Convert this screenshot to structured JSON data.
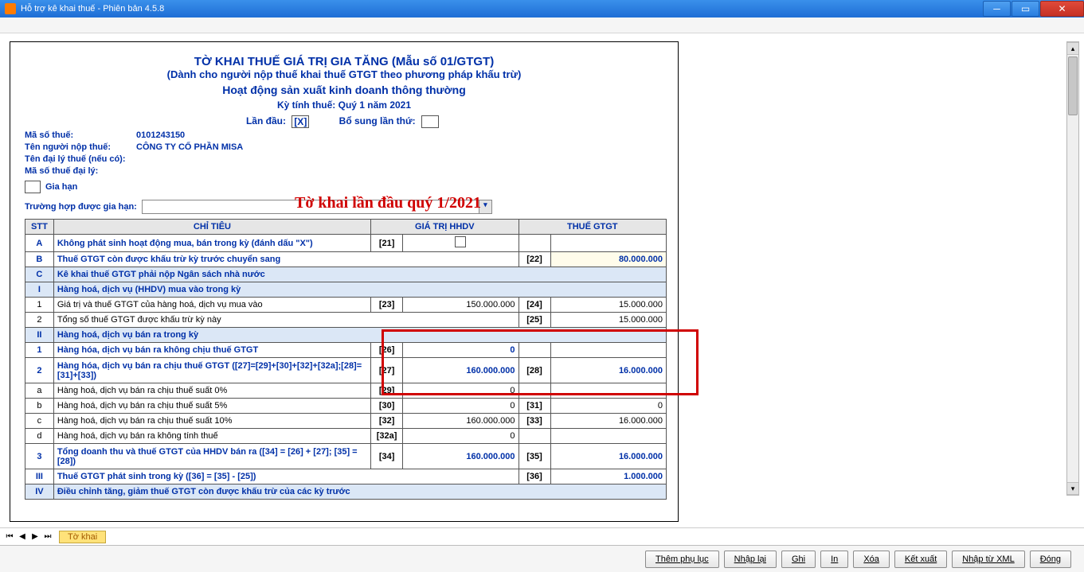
{
  "window": {
    "title": "Hỗ trợ kê khai thuế -   Phiên bản 4.5.8"
  },
  "form": {
    "title": "TỜ KHAI THUẾ GIÁ TRỊ GIA TĂNG (Mẫu số 01/GTGT)",
    "subtitle": "(Dành cho người nộp thuế khai thuế GTGT theo phương pháp khấu trừ)",
    "activity": "Hoạt động sản xuất kinh doanh thông thường",
    "period": "Kỳ tính thuế: Quý 1 năm 2021",
    "landau_lbl": "Lần đầu:",
    "landau_val": "[X]",
    "bosung_lbl": "Bổ sung lần thứ:",
    "bosung_val": "",
    "info": {
      "mst_lbl": "Mã số thuế:",
      "mst_val": "0101243150",
      "ten_lbl": "Tên người nộp thuế:",
      "ten_val": "CÔNG TY CỔ PHẦN MISA",
      "dl_lbl": "Tên đại lý thuế (nếu có):",
      "dl_val": "",
      "mstdl_lbl": "Mã số thuế đại lý:",
      "mstdl_val": ""
    },
    "red_note": "Tờ khai lần đầu quý 1/2021",
    "giahan_lbl": "Gia hạn",
    "ext_lbl": "Trường hợp được gia hạn:"
  },
  "headers": {
    "stt": "STT",
    "chitieu": "CHỈ TIÊU",
    "hhdv": "GIÁ TRỊ HHDV",
    "thue": "THUẾ GTGT"
  },
  "rows": {
    "A": {
      "stt": "A",
      "desc": "Không phát sinh hoạt động mua, bán trong kỳ (đánh dấu \"X\")",
      "c1": "[21]",
      "v1": "",
      "c2": "",
      "v2": ""
    },
    "B": {
      "stt": "B",
      "desc": "Thuế GTGT còn được khấu trừ kỳ trước chuyển sang",
      "c1": "",
      "v1": "",
      "c2": "[22]",
      "v2": "80.000.000"
    },
    "C": {
      "stt": "C",
      "desc": "Kê khai thuế GTGT phải nộp Ngân sách nhà nước"
    },
    "I": {
      "stt": "I",
      "desc": "Hàng hoá, dịch vụ (HHDV) mua vào trong kỳ"
    },
    "r1": {
      "stt": "1",
      "desc": "Giá trị và thuế GTGT của hàng hoá, dịch vụ mua vào",
      "c1": "[23]",
      "v1": "150.000.000",
      "c2": "[24]",
      "v2": "15.000.000"
    },
    "r2": {
      "stt": "2",
      "desc": "Tổng số thuế GTGT được khấu trừ kỳ này",
      "c1": "",
      "v1": "",
      "c2": "[25]",
      "v2": "15.000.000"
    },
    "II": {
      "stt": "II",
      "desc": "Hàng hoá, dịch vụ bán ra trong kỳ"
    },
    "s1": {
      "stt": "1",
      "desc": "Hàng hóa, dịch vụ bán ra không chịu thuế GTGT",
      "c1": "[26]",
      "v1": "0",
      "c2": "",
      "v2": ""
    },
    "s2": {
      "stt": "2",
      "desc": "Hàng hóa, dịch vụ bán ra chịu thuế GTGT ([27]=[29]+[30]+[32]+[32a];[28]=[31]+[33])",
      "c1": "[27]",
      "v1": "160.000.000",
      "c2": "[28]",
      "v2": "16.000.000"
    },
    "sa": {
      "stt": "a",
      "desc": "Hàng hoá, dịch vụ bán ra chịu thuế suất 0%",
      "c1": "[29]",
      "v1": "0",
      "c2": "",
      "v2": ""
    },
    "sb": {
      "stt": "b",
      "desc": "Hàng hoá, dịch vụ bán ra chịu thuế suất 5%",
      "c1": "[30]",
      "v1": "0",
      "c2": "[31]",
      "v2": "0"
    },
    "sc": {
      "stt": "c",
      "desc": "Hàng hoá, dịch vụ bán ra chịu thuế suất 10%",
      "c1": "[32]",
      "v1": "160.000.000",
      "c2": "[33]",
      "v2": "16.000.000"
    },
    "sd": {
      "stt": "d",
      "desc": "Hàng hoá, dịch vụ bán ra không tính thuế",
      "c1": "[32a]",
      "v1": "0",
      "c2": "",
      "v2": ""
    },
    "s3": {
      "stt": "3",
      "desc": "Tổng doanh thu và thuế GTGT của HHDV bán ra ([34] = [26] + [27]; [35] = [28])",
      "c1": "[34]",
      "v1": "160.000.000",
      "c2": "[35]",
      "v2": "16.000.000"
    },
    "III": {
      "stt": "III",
      "desc": "Thuế GTGT phát sinh trong kỳ ([36] = [35] - [25])",
      "c1": "",
      "v1": "",
      "c2": "[36]",
      "v2": "1.000.000"
    },
    "IV": {
      "stt": "IV",
      "desc": "Điều chỉnh tăng, giảm thuế GTGT còn được khấu trừ của các kỳ trước"
    }
  },
  "tab": {
    "name": "Tờ khai"
  },
  "footer": {
    "themphuluc": "Thêm phụ lục",
    "nhaplai": "Nhập lại",
    "ghi": "Ghi",
    "in": "In",
    "xoa": "Xóa",
    "ketxuat": "Kết xuất",
    "nhapxml": "Nhập từ XML",
    "dong": "Đóng"
  }
}
